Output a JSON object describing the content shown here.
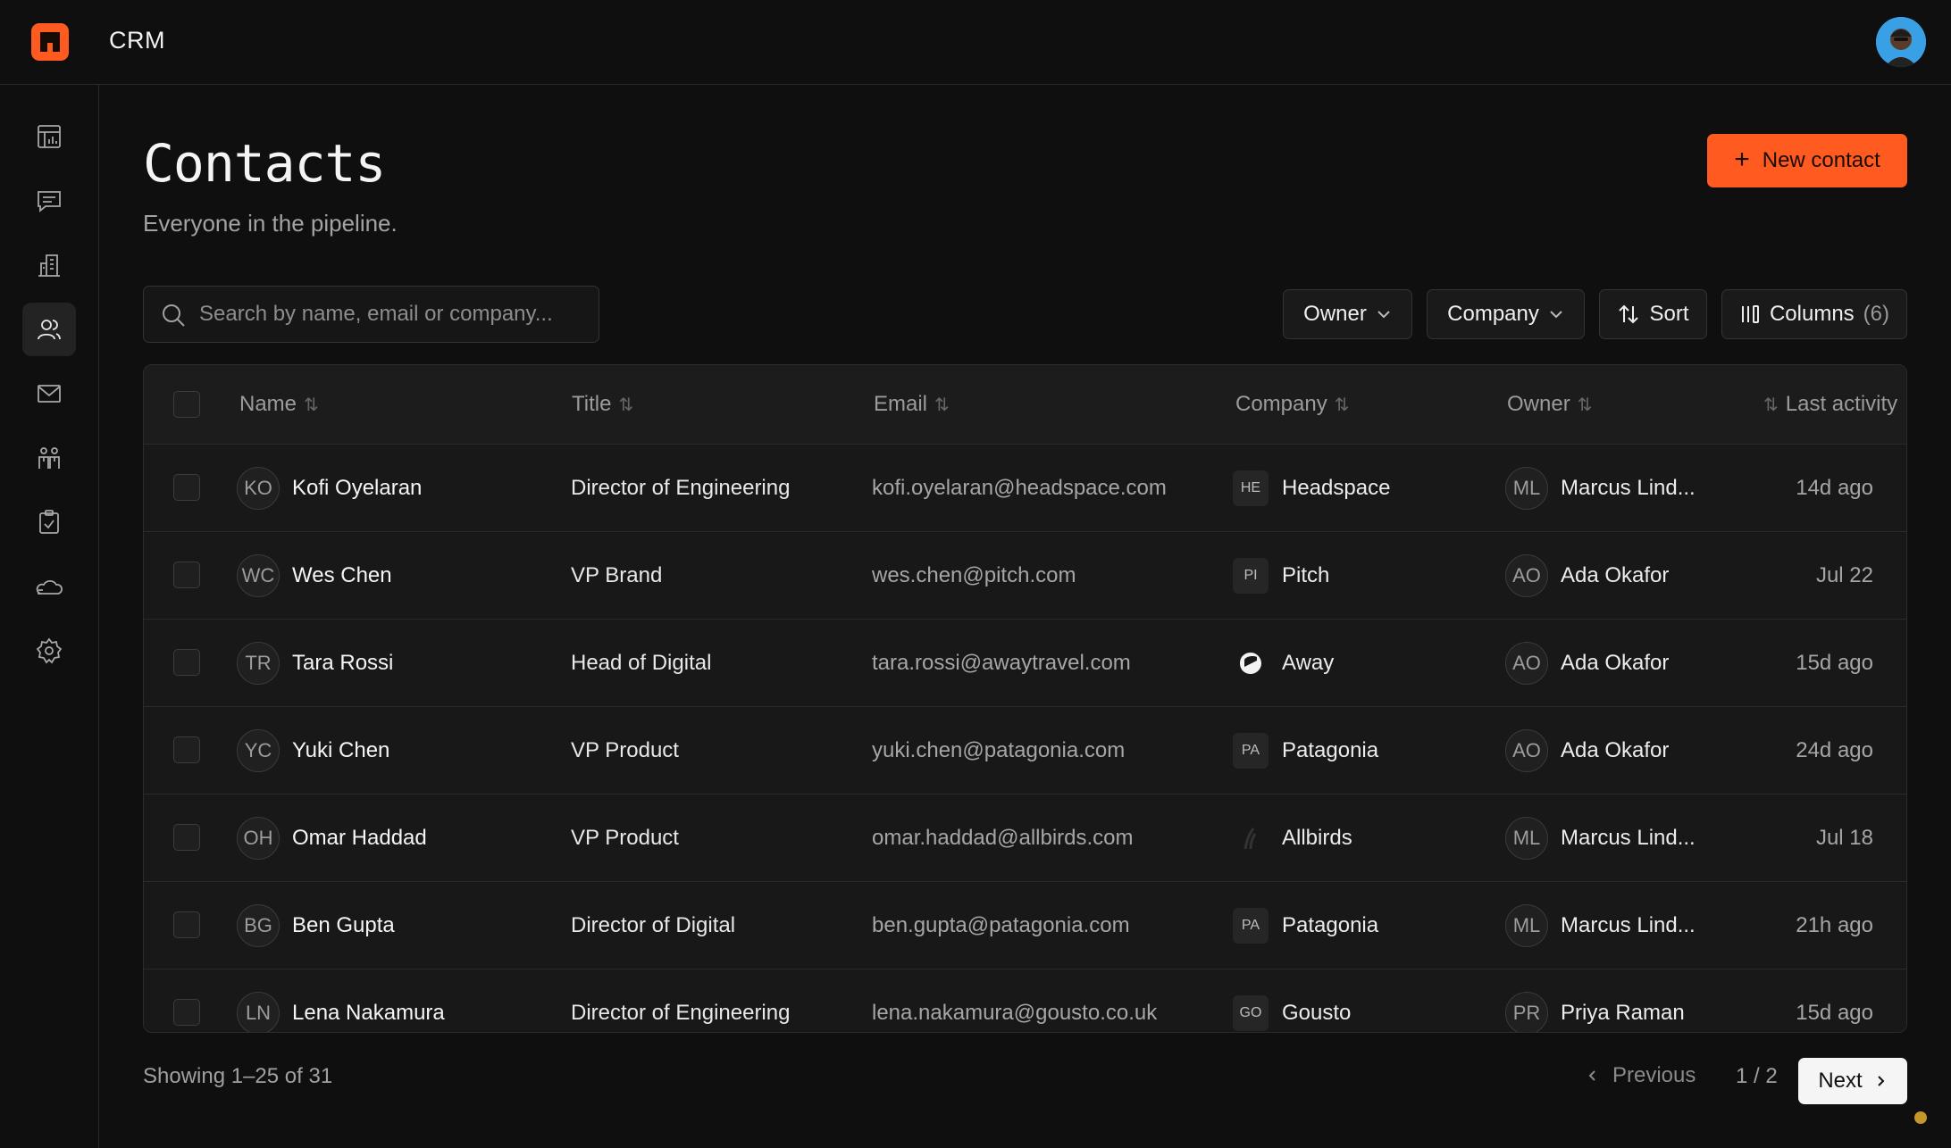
{
  "app": {
    "title": "CRM"
  },
  "sidebar": {
    "items": [
      {
        "name": "dashboard",
        "icon": "chart-icon"
      },
      {
        "name": "conversations",
        "icon": "message-icon"
      },
      {
        "name": "companies",
        "icon": "building-icon"
      },
      {
        "name": "contacts",
        "icon": "users-icon",
        "active": true
      },
      {
        "name": "mail",
        "icon": "mail-icon"
      },
      {
        "name": "teams",
        "icon": "team-icon"
      },
      {
        "name": "tasks",
        "icon": "clipboard-icon"
      },
      {
        "name": "integrations",
        "icon": "cloud-icon"
      },
      {
        "name": "settings",
        "icon": "gear-icon"
      }
    ]
  },
  "header": {
    "title": "Contacts",
    "subtitle": "Everyone in the pipeline.",
    "new_button_label": "New contact"
  },
  "search": {
    "placeholder": "Search by name, email or company..."
  },
  "filters": {
    "owner_label": "Owner",
    "company_label": "Company",
    "sort_label": "Sort",
    "columns_label": "Columns",
    "columns_count": "(6)"
  },
  "table": {
    "columns": [
      "Name",
      "Title",
      "Email",
      "Company",
      "Owner",
      "Last activity"
    ],
    "rows": [
      {
        "initials": "KO",
        "name": "Kofi Oyelaran",
        "title": "Director of Engineering",
        "email": "kofi.oyelaran@headspace.com",
        "company_logo": "HE",
        "company": "Headspace",
        "owner_initials": "ML",
        "owner": "Marcus Lind...",
        "last_activity": "14d ago"
      },
      {
        "initials": "WC",
        "name": "Wes Chen",
        "title": "VP Brand",
        "email": "wes.chen@pitch.com",
        "company_logo": "PI",
        "company": "Pitch",
        "owner_initials": "AO",
        "owner": "Ada Okafor",
        "last_activity": "Jul 22"
      },
      {
        "initials": "TR",
        "name": "Tara Rossi",
        "title": "Head of Digital",
        "email": "tara.rossi@awaytravel.com",
        "company_logo": "",
        "company": "Away",
        "owner_initials": "AO",
        "owner": "Ada Okafor",
        "last_activity": "15d ago"
      },
      {
        "initials": "YC",
        "name": "Yuki Chen",
        "title": "VP Product",
        "email": "yuki.chen@patagonia.com",
        "company_logo": "PA",
        "company": "Patagonia",
        "owner_initials": "AO",
        "owner": "Ada Okafor",
        "last_activity": "24d ago"
      },
      {
        "initials": "OH",
        "name": "Omar Haddad",
        "title": "VP Product",
        "email": "omar.haddad@allbirds.com",
        "company_logo": "",
        "company": "Allbirds",
        "owner_initials": "ML",
        "owner": "Marcus Lind...",
        "last_activity": "Jul 18"
      },
      {
        "initials": "BG",
        "name": "Ben Gupta",
        "title": "Director of Digital",
        "email": "ben.gupta@patagonia.com",
        "company_logo": "PA",
        "company": "Patagonia",
        "owner_initials": "ML",
        "owner": "Marcus Lind...",
        "last_activity": "21h ago"
      },
      {
        "initials": "LN",
        "name": "Lena Nakamura",
        "title": "Director of Engineering",
        "email": "lena.nakamura@gousto.co.uk",
        "company_logo": "GO",
        "company": "Gousto",
        "owner_initials": "PR",
        "owner": "Priya Raman",
        "last_activity": "15d ago"
      }
    ]
  },
  "pagination": {
    "showing": "Showing 1–25 of 31",
    "previous_label": "Previous",
    "page_indicator": "1 / 2",
    "next_label": "Next"
  },
  "colors": {
    "accent": "#ff5a1f",
    "background": "#0f0f0f",
    "status_dot": "#c7962b"
  }
}
